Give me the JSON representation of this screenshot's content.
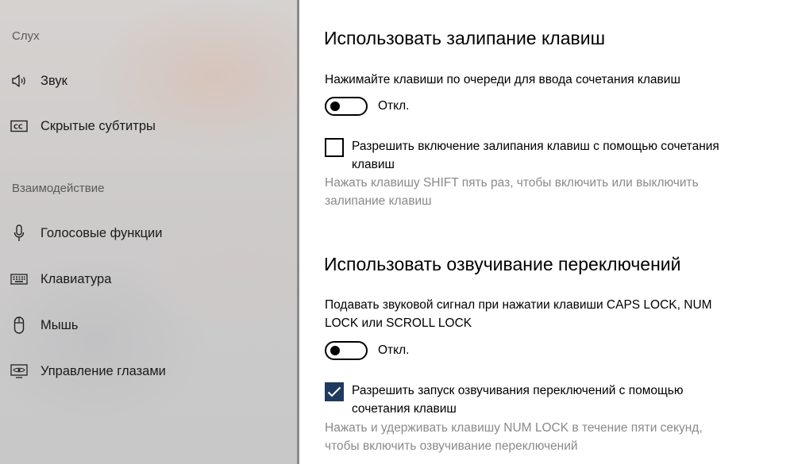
{
  "sidebar": {
    "section_hearing": "Слух",
    "section_interaction": "Взаимодействие",
    "items": [
      {
        "label": "Звук",
        "icon": "speaker-icon"
      },
      {
        "label": "Скрытые субтитры",
        "icon": "closed-captions-icon"
      },
      {
        "label": "Голосовые функции",
        "icon": "microphone-icon"
      },
      {
        "label": "Клавиатура",
        "icon": "keyboard-icon"
      },
      {
        "label": "Мышь",
        "icon": "mouse-icon"
      },
      {
        "label": "Управление глазами",
        "icon": "eye-control-icon"
      }
    ]
  },
  "sticky_keys": {
    "title": "Использовать залипание клавиш",
    "description": "Нажимайте клавиши по очереди для ввода сочетания клавиш",
    "toggle_state": "Откл.",
    "toggle_on": false,
    "checkbox_line1": "Разрешить включение залипания клавиш с помощью сочетания",
    "checkbox_line2": "клавиш",
    "checkbox_checked": false,
    "hint_line1": "Нажать клавишу SHIFT пять раз, чтобы включить или выключить",
    "hint_line2": "залипание клавиш"
  },
  "toggle_keys": {
    "title": "Использовать озвучивание переключений",
    "description_line1": "Подавать звуковой сигнал при нажатии клавиши CAPS LOCK, NUM",
    "description_line2": "LOCK или SCROLL LOCK",
    "toggle_state": "Откл.",
    "toggle_on": false,
    "checkbox_line1": "Разрешить запуск озвучивания переключений с помощью",
    "checkbox_line2": "сочетания клавиш",
    "checkbox_checked": true,
    "hint_line1": "Нажать и удерживать клавишу NUM LOCK в течение пяти секунд,",
    "hint_line2": "чтобы включить озвучивание переключений"
  },
  "colors": {
    "checkbox_checked": "#1f3a5f",
    "hint_text": "#8a8a8a"
  }
}
